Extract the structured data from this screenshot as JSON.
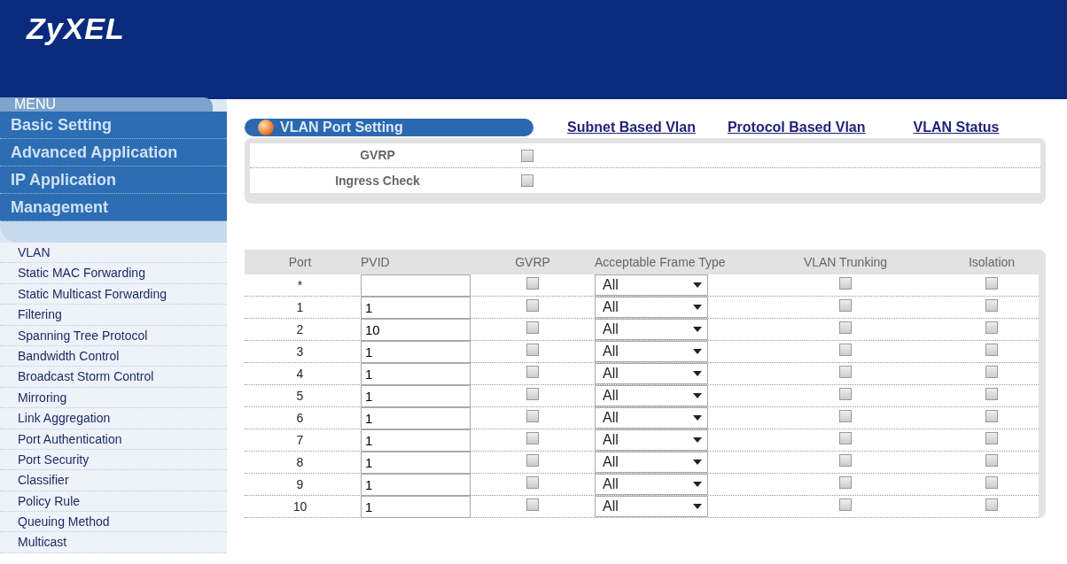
{
  "logo": "ZyXEL",
  "menu": {
    "label": "MENU",
    "sections": [
      {
        "label": "Basic Setting"
      },
      {
        "label": "Advanced Application"
      },
      {
        "label": "IP Application"
      },
      {
        "label": "Management"
      }
    ],
    "items": [
      {
        "label": "VLAN"
      },
      {
        "label": "Static MAC Forwarding"
      },
      {
        "label": "Static Multicast Forwarding"
      },
      {
        "label": "Filtering"
      },
      {
        "label": "Spanning Tree Protocol"
      },
      {
        "label": "Bandwidth Control"
      },
      {
        "label": "Broadcast Storm Control"
      },
      {
        "label": "Mirroring"
      },
      {
        "label": "Link Aggregation"
      },
      {
        "label": "Port Authentication"
      },
      {
        "label": "Port Security"
      },
      {
        "label": "Classifier"
      },
      {
        "label": "Policy Rule"
      },
      {
        "label": "Queuing Method"
      },
      {
        "label": "Multicast"
      }
    ]
  },
  "page_title": "VLAN Port Setting",
  "links": [
    "Subnet Based Vlan",
    "Protocol Based Vlan",
    "VLAN Status"
  ],
  "global_settings": [
    {
      "label": "GVRP",
      "checked": false
    },
    {
      "label": "Ingress Check",
      "checked": false
    }
  ],
  "table": {
    "columns": [
      "Port",
      "PVID",
      "GVRP",
      "Acceptable Frame Type",
      "VLAN Trunking",
      "Isolation"
    ],
    "rows": [
      {
        "port": "*",
        "pvid": "",
        "gvrp": false,
        "frame_type": "All",
        "trunking": false,
        "isolation": false
      },
      {
        "port": "1",
        "pvid": "1",
        "gvrp": false,
        "frame_type": "All",
        "trunking": false,
        "isolation": false
      },
      {
        "port": "2",
        "pvid": "10",
        "gvrp": false,
        "frame_type": "All",
        "trunking": false,
        "isolation": false
      },
      {
        "port": "3",
        "pvid": "1",
        "gvrp": false,
        "frame_type": "All",
        "trunking": false,
        "isolation": false
      },
      {
        "port": "4",
        "pvid": "1",
        "gvrp": false,
        "frame_type": "All",
        "trunking": false,
        "isolation": false
      },
      {
        "port": "5",
        "pvid": "1",
        "gvrp": false,
        "frame_type": "All",
        "trunking": false,
        "isolation": false
      },
      {
        "port": "6",
        "pvid": "1",
        "gvrp": false,
        "frame_type": "All",
        "trunking": false,
        "isolation": false
      },
      {
        "port": "7",
        "pvid": "1",
        "gvrp": false,
        "frame_type": "All",
        "trunking": false,
        "isolation": false
      },
      {
        "port": "8",
        "pvid": "1",
        "gvrp": false,
        "frame_type": "All",
        "trunking": false,
        "isolation": false
      },
      {
        "port": "9",
        "pvid": "1",
        "gvrp": false,
        "frame_type": "All",
        "trunking": false,
        "isolation": false
      },
      {
        "port": "10",
        "pvid": "1",
        "gvrp": false,
        "frame_type": "All",
        "trunking": false,
        "isolation": false
      }
    ]
  }
}
